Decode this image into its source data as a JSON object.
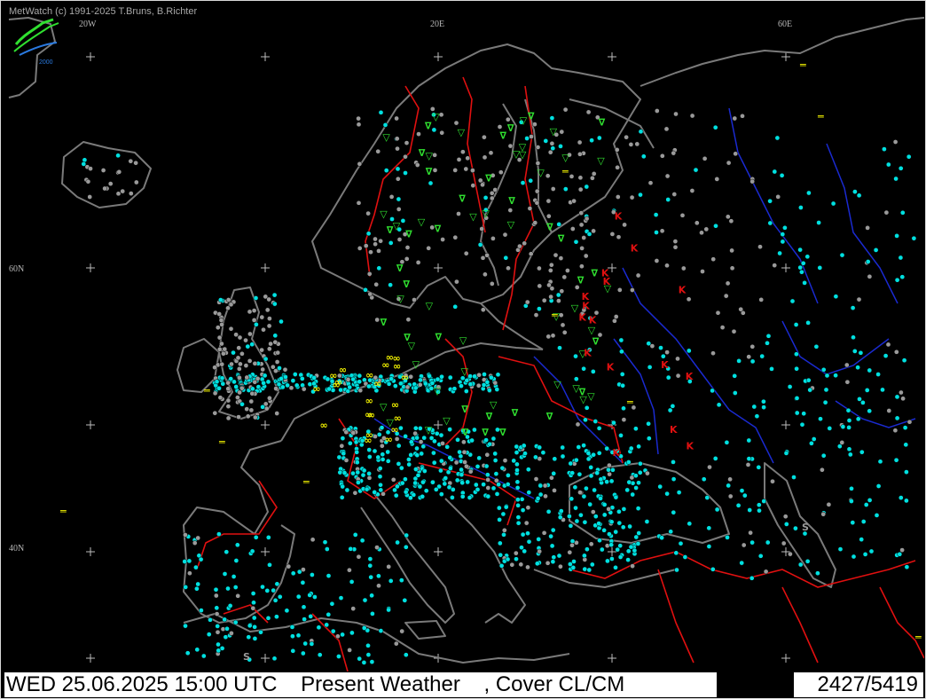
{
  "credit": "MetWatch  (c) 1991-2025 T.Bruns, B.Richter",
  "coords": {
    "lon_20w": "20W",
    "lon_20e": "20E",
    "lon_60e": "60E",
    "lat_60n": "60N",
    "lat_40n": "40N"
  },
  "status_bar": {
    "datetime": "WED 25.06.2025 15:00 UTC",
    "product": "Present Weather",
    "overlay": ", Cover CL/CM",
    "count": "2427/5419"
  },
  "colors": {
    "coastline": "#7a7a7a",
    "borders": "#e01010",
    "rivers": "#1a2ad0",
    "station_clear": "#00e0e0",
    "station_cloudy": "#9a9a9a",
    "shower_rain": "#30e030",
    "thunder": "#e01010",
    "fog_haze": "#f0f000"
  },
  "icons": [
    "logo-icon",
    "shower-symbol",
    "thunderstorm-symbol",
    "haze-symbol",
    "fog-symbol",
    "dust-symbol"
  ]
}
